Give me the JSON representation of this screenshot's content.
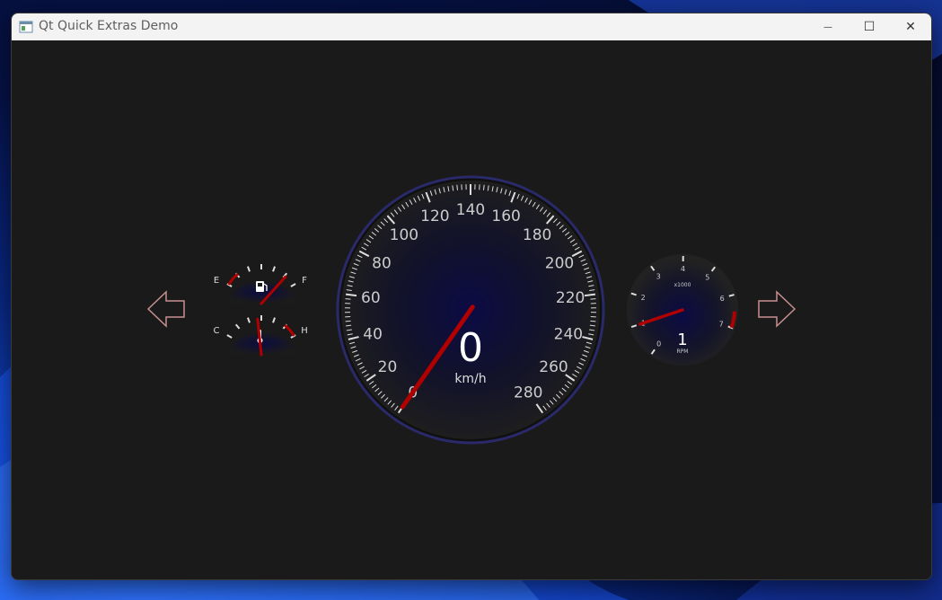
{
  "window": {
    "title": "Qt Quick Extras Demo"
  },
  "controls": {
    "minimize": "—",
    "maximize": "☐",
    "close": "✕"
  },
  "fuel_gauge": {
    "empty_label": "E",
    "full_label": "F",
    "level": 0.85,
    "icon": "fuel-pump-icon"
  },
  "temp_gauge": {
    "cold_label": "C",
    "hot_label": "H",
    "level": 0.45,
    "icon": "thermometer-icon"
  },
  "speedometer": {
    "value": "0",
    "unit": "km/h",
    "ticks": [
      "0",
      "20",
      "40",
      "60",
      "80",
      "100",
      "120",
      "140",
      "160",
      "180",
      "200",
      "220",
      "240",
      "260",
      "280"
    ]
  },
  "tachometer": {
    "value": "1",
    "unit": "RPM",
    "multiplier": "x1000",
    "ticks": [
      "0",
      "1",
      "2",
      "3",
      "4",
      "5",
      "6",
      "7"
    ]
  },
  "nav": {
    "left": "left-arrow-icon",
    "right": "right-arrow-icon"
  },
  "colors": {
    "needle": "#b00000",
    "dial_center": "#0a0a3a",
    "label": "#cccccc",
    "redline": "#b00000"
  }
}
